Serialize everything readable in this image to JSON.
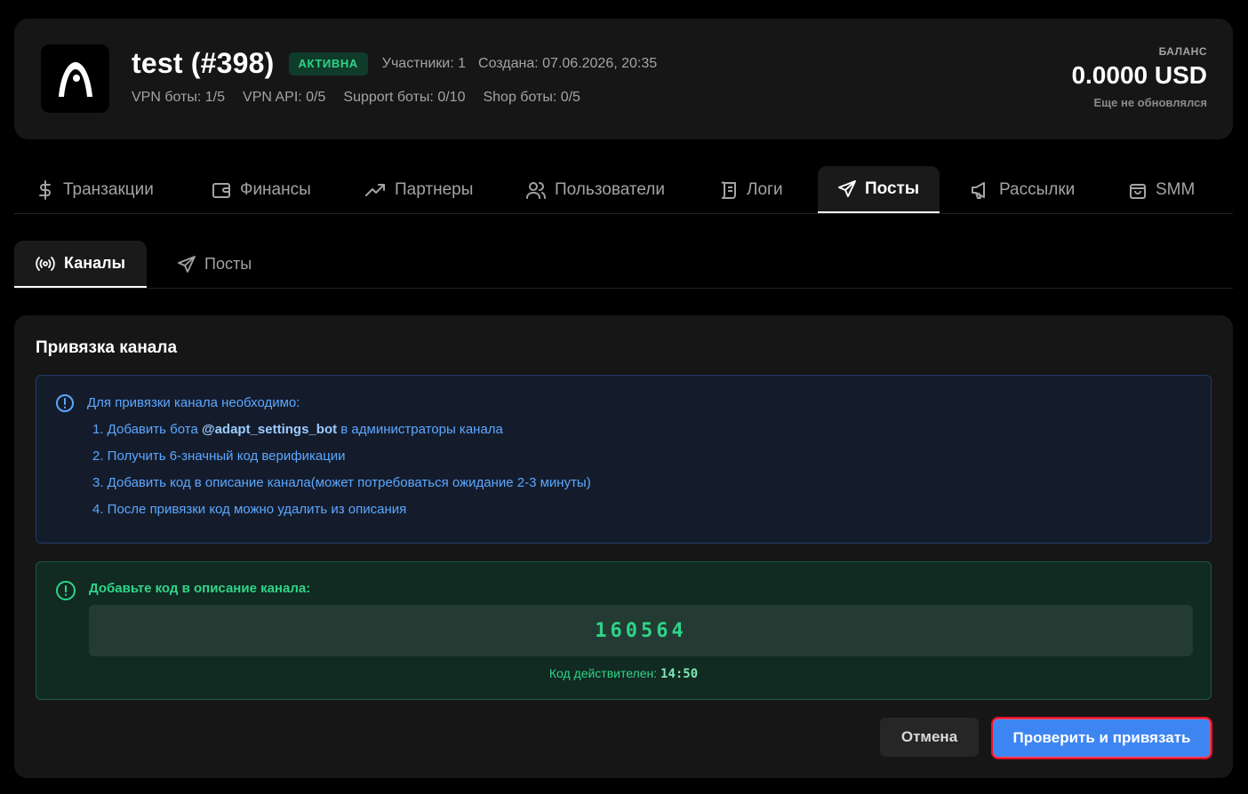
{
  "header": {
    "title": "test (#398)",
    "status_badge": "АКТИВНА",
    "participants": "Участники: 1",
    "created": "Создана: 07.06.2026, 20:35",
    "limits": [
      "VPN боты: 1/5",
      "VPN API: 0/5",
      "Support боты: 0/10",
      "Shop боты: 0/5"
    ],
    "balance_label": "БАЛАНС",
    "balance_value": "0.0000 USD",
    "balance_sub": "Еще не обновлялся",
    "logo_icon": "arch-logo-icon"
  },
  "main_tabs": [
    {
      "label": "Транзакции",
      "icon": "dollar-icon"
    },
    {
      "label": "Финансы",
      "icon": "wallet-icon"
    },
    {
      "label": "Партнеры",
      "icon": "trending-up-icon"
    },
    {
      "label": "Пользователи",
      "icon": "users-icon"
    },
    {
      "label": "Логи",
      "icon": "scroll-icon"
    },
    {
      "label": "Посты",
      "icon": "send-icon",
      "active": true
    },
    {
      "label": "Рассылки",
      "icon": "megaphone-icon"
    },
    {
      "label": "SMM",
      "icon": "shopping-bag-icon"
    }
  ],
  "sub_tabs": [
    {
      "label": "Каналы",
      "icon": "broadcast-icon",
      "active": true
    },
    {
      "label": "Посты",
      "icon": "send-icon"
    }
  ],
  "card": {
    "title": "Привязка канала",
    "info": {
      "heading": "Для привязки канала необходимо:",
      "step1_prefix": "1. Добавить бота ",
      "step1_bot": "@adapt_settings_bot",
      "step1_suffix": " в администраторы канала",
      "step2": "2. Получить 6-значный код верификации",
      "step3": "3. Добавить код в описание канала(может потребоваться ожидание 2-3 минуты)",
      "step4": "4. После привязки код можно удалить из описания"
    },
    "code": {
      "heading": "Добавьте код в описание канала:",
      "value": "160564",
      "valid_label": "Код действителен: ",
      "timer": "14:50"
    },
    "cancel_label": "Отмена",
    "confirm_label": "Проверить и привязать"
  },
  "colors": {
    "accent_blue": "#3d86f2",
    "success_green": "#2fd488",
    "info_blue": "#5ca7ff",
    "highlight_red": "#e0132a"
  }
}
